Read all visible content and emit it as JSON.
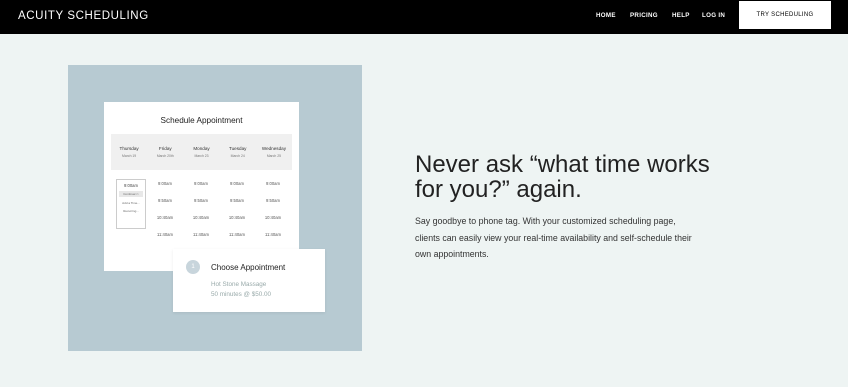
{
  "header": {
    "logo": "ACUITY SCHEDULING",
    "nav": [
      "HOME",
      "PRICING",
      "HELP",
      "LOG IN"
    ],
    "cta": "TRY SCHEDULING"
  },
  "illustration": {
    "card_title": "Schedule Appointment",
    "days": [
      {
        "name": "Thursday",
        "date": "March 19"
      },
      {
        "name": "Friday",
        "date": "March 20th"
      },
      {
        "name": "Monday",
        "date": "March 23"
      },
      {
        "name": "Tuesday",
        "date": "March 24"
      },
      {
        "name": "Wednesday",
        "date": "March 25"
      }
    ],
    "times": [
      "9:00am",
      "9:50am",
      "10:40am",
      "11:40am"
    ],
    "picker": {
      "time": "9:00am",
      "options": [
        "Continue>>",
        "Add a Time...",
        "Recurring..."
      ]
    },
    "choose": {
      "step": "1",
      "title": "Choose Appointment",
      "service": "Hot Stone Massage",
      "detail": "50 minutes @ $50.00"
    }
  },
  "hero": {
    "headline": "Never ask “what time works for you?” again.",
    "description": "Say goodbye to phone tag. With your customized scheduling page, clients can easily view your real-time availability and self-schedule their own appointments."
  }
}
